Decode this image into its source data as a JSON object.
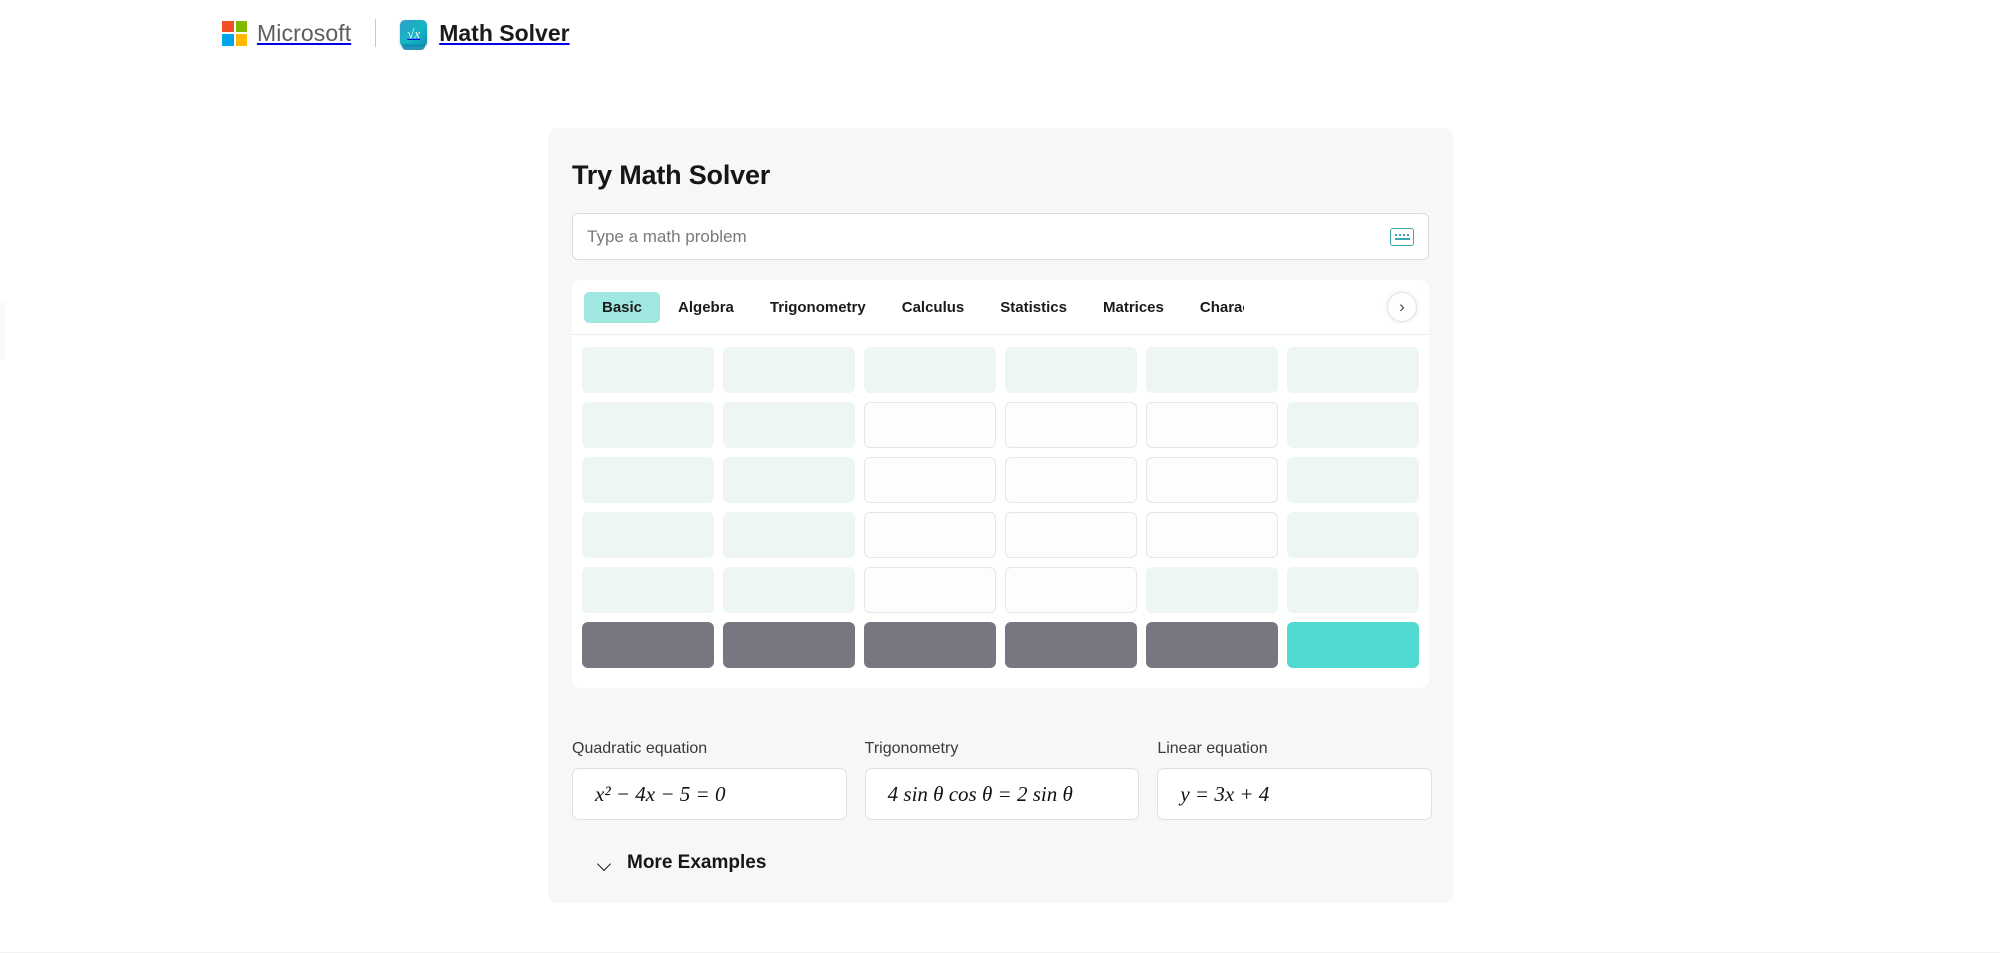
{
  "header": {
    "microsoft_label": "Microsoft",
    "app_name": "Math Solver",
    "app_icon_glyph": "√x",
    "logo_colors": {
      "red": "#F25022",
      "green": "#7FBA00",
      "blue": "#00A4EF",
      "yellow": "#FFB900"
    }
  },
  "card": {
    "title": "Try Math Solver"
  },
  "search": {
    "value": "",
    "placeholder": "Type a math problem",
    "keyboard_icon": "keyboard-icon",
    "icon_color": "#3aa8a8"
  },
  "keypad": {
    "tabs": [
      {
        "label": "Basic",
        "selected": true
      },
      {
        "label": "Algebra",
        "selected": false
      },
      {
        "label": "Trigonometry",
        "selected": false
      },
      {
        "label": "Calculus",
        "selected": false
      },
      {
        "label": "Statistics",
        "selected": false
      },
      {
        "label": "Matrices",
        "selected": false
      },
      {
        "label": "Charac",
        "selected": false
      }
    ],
    "selected_tab_color": "#9fe7df",
    "scroll_right_icon": "chevron-right-icon",
    "keys": [
      {
        "label": "",
        "style": "mint"
      },
      {
        "label": "",
        "style": "mint"
      },
      {
        "label": "",
        "style": "mint"
      },
      {
        "label": "",
        "style": "mint"
      },
      {
        "label": "",
        "style": "mint"
      },
      {
        "label": "",
        "style": "mint"
      },
      {
        "label": "",
        "style": "mint"
      },
      {
        "label": "",
        "style": "mint"
      },
      {
        "label": "",
        "style": "white"
      },
      {
        "label": "",
        "style": "white"
      },
      {
        "label": "",
        "style": "white"
      },
      {
        "label": "",
        "style": "mint"
      },
      {
        "label": "",
        "style": "mint"
      },
      {
        "label": "",
        "style": "mint"
      },
      {
        "label": "",
        "style": "white"
      },
      {
        "label": "",
        "style": "white"
      },
      {
        "label": "",
        "style": "white"
      },
      {
        "label": "",
        "style": "mint"
      },
      {
        "label": "",
        "style": "mint"
      },
      {
        "label": "",
        "style": "mint"
      },
      {
        "label": "",
        "style": "white"
      },
      {
        "label": "",
        "style": "white"
      },
      {
        "label": "",
        "style": "white"
      },
      {
        "label": "",
        "style": "mint"
      },
      {
        "label": "",
        "style": "mint"
      },
      {
        "label": "",
        "style": "mint"
      },
      {
        "label": "",
        "style": "white"
      },
      {
        "label": "",
        "style": "white"
      },
      {
        "label": "",
        "style": "mint"
      },
      {
        "label": "",
        "style": "mint"
      },
      {
        "label": "",
        "style": "gray"
      },
      {
        "label": "",
        "style": "gray"
      },
      {
        "label": "",
        "style": "gray"
      },
      {
        "label": "",
        "style": "gray"
      },
      {
        "label": "",
        "style": "gray"
      },
      {
        "label": "",
        "style": "teal"
      }
    ],
    "key_colors": {
      "mint": "#eef6f4",
      "white": "#fdfdfd",
      "gray": "#767780",
      "teal": "#4fd9d0"
    }
  },
  "examples": [
    {
      "label": "Quadratic equation",
      "formula": "x² − 4x − 5 = 0"
    },
    {
      "label": "Trigonometry",
      "formula": "4 sin θ cos θ = 2 sin θ"
    },
    {
      "label": "Linear equation",
      "formula": "y = 3x + 4"
    }
  ],
  "more_examples": {
    "label": "More Examples",
    "icon": "chevron-down-icon"
  }
}
